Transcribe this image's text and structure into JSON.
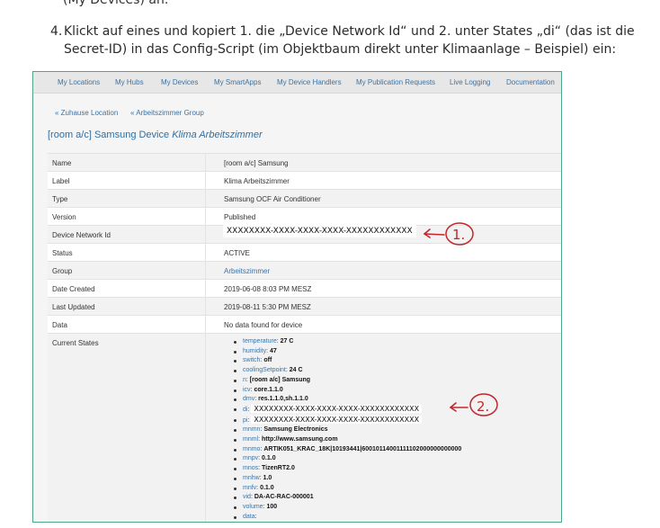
{
  "article": {
    "prev_line": "(My Devices) an.",
    "step_number": "4.",
    "step_text": "Klickt auf eines und kopiert 1. die „Device Network Id“ und 2. unter States „di“ (das ist die Secret-ID) in das Config-Script (im Objektbaum direkt unter Klimaanlage – Beispiel) ein:"
  },
  "nav": {
    "items": [
      "My Locations",
      "My Hubs",
      "My Devices",
      "My SmartApps",
      "My Device Handlers",
      "My Publication Requests",
      "Live Logging",
      "Documentation"
    ]
  },
  "breadcrumbs": [
    "« Zuhause Location",
    "« Arbeitszimmer Group"
  ],
  "page": {
    "title_prefix": "[room a/c] Samsung Device",
    "title_name": "Klima Arbeitszimmer"
  },
  "details": {
    "rows": [
      {
        "label": "Name",
        "value": "[room a/c] Samsung"
      },
      {
        "label": "Label",
        "value": "Klima Arbeitszimmer"
      },
      {
        "label": "Type",
        "value": "Samsung OCF Air Conditioner"
      },
      {
        "label": "Version",
        "value": "Published"
      },
      {
        "label": "Device Network Id",
        "value": ""
      },
      {
        "label": "Status",
        "value": "ACTIVE"
      },
      {
        "label": "Group",
        "value": "Arbeitszimmer"
      },
      {
        "label": "Date Created",
        "value": "2019-06-08 8:03 PM MESZ"
      },
      {
        "label": "Last Updated",
        "value": "2019-08-11 5:30 PM MESZ"
      },
      {
        "label": "Data",
        "value": "No data found for device"
      },
      {
        "label": "Current States",
        "value": ""
      }
    ]
  },
  "redacted": {
    "network_id": "XXXXXXXX-XXXX-XXXX-XXXX-XXXXXXXXXXXX",
    "di": "XXXXXXXX-XXXX-XXXX-XXXX-XXXXXXXXXXXX",
    "pi": "XXXXXXXX-XXXX-XXXX-XXXX-XXXXXXXXXXXX"
  },
  "states": [
    {
      "name": "temperature",
      "value": "27 C"
    },
    {
      "name": "humidity",
      "value": "47"
    },
    {
      "name": "switch",
      "value": "off"
    },
    {
      "name": "coolingSetpoint",
      "value": "24 C"
    },
    {
      "name": "n",
      "value": "[room a/c] Samsung"
    },
    {
      "name": "icv",
      "value": "core.1.1.0"
    },
    {
      "name": "dmv",
      "value": "res.1.1.0,sh.1.1.0"
    },
    {
      "name": "di",
      "value": ""
    },
    {
      "name": "pi",
      "value": ""
    },
    {
      "name": "mnmn",
      "value": "Samsung Electronics"
    },
    {
      "name": "mnml",
      "value": "http://www.samsung.com"
    },
    {
      "name": "mnmo",
      "value": "ARTIK051_KRAC_18K|10193441|60010114001111102000000000000"
    },
    {
      "name": "mnpv",
      "value": "0.1.0"
    },
    {
      "name": "mnos",
      "value": "TizenRT2.0"
    },
    {
      "name": "mnhw",
      "value": "1.0"
    },
    {
      "name": "mnfv",
      "value": "0.1.0"
    },
    {
      "name": "vid",
      "value": "DA-AC-RAC-000001"
    },
    {
      "name": "volume",
      "value": "100"
    },
    {
      "name": "data",
      "value": ""
    }
  ],
  "annotations": {
    "mark1": "1.",
    "mark2": "2.",
    "ink_color": "#c0272d"
  }
}
